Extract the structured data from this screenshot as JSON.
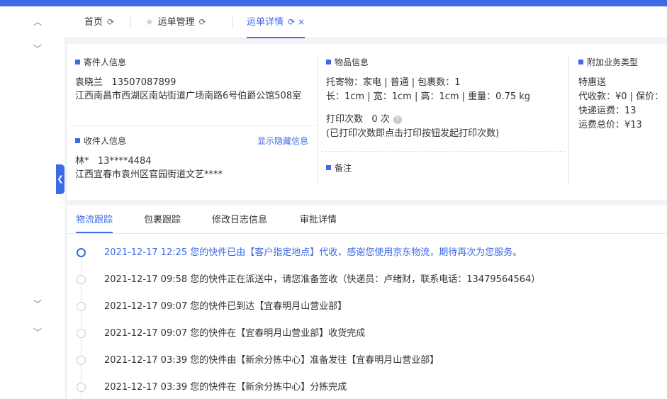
{
  "colors": {
    "accent": "#3d6be6",
    "background": "#f2f3f5"
  },
  "sidebar": {
    "icons": [
      "chevron-up-icon",
      "chevron-down-icon",
      "chevron-down-icon",
      "chevron-down-icon"
    ]
  },
  "tabs": {
    "home": "首页",
    "waybill_mgmt": "运单管理",
    "waybill_detail": "运单详情",
    "refresh_glyph": "⟳",
    "close_glyph": "×",
    "star_glyph": "★"
  },
  "sender": {
    "title": "寄件人信息",
    "name": "袁晓兰",
    "phone": "13507087899",
    "address": "江西南昌市西湖区南站街道广场南路6号伯爵公馆508室"
  },
  "receiver": {
    "title": "收件人信息",
    "show_hidden": "显示隐藏信息",
    "name": "林*",
    "phone": "13****4484",
    "address": "江西宜春市袁州区官园街道文艺****"
  },
  "goods": {
    "title": "物品信息",
    "line1": "托寄物：家电 | 普通 | 包裹数：1",
    "line2": "长：1cm | 宽：1cm | 高：1cm | 重量：0.75 kg",
    "print_label": "打印次数",
    "print_value": "0 次",
    "print_note": "(已打印次数即点击打印按钮发起打印次数)",
    "help_glyph": "?"
  },
  "remark": {
    "title": "备注"
  },
  "extra": {
    "title": "附加业务类型",
    "service": "特惠送",
    "cod": "代收款：¥0 | 保价：",
    "express_fee": "快递运费：13",
    "total_fee": "运费总价：¥13"
  },
  "logistics": {
    "tabs": [
      "物流跟踪",
      "包裹跟踪",
      "修改日志信息",
      "审批详情"
    ],
    "events": [
      "2021-12-17 12:25 您的快件已由【客户指定地点】代收，感谢您使用京东物流，期待再次为您服务。",
      "2021-12-17 09:58 您的快件正在派送中，请您准备签收（快递员：卢绪财，联系电话：13479564564）",
      "2021-12-17 09:07 您的快件已到达【宜春明月山营业部】",
      "2021-12-17 09:07 您的快件在【宜春明月山营业部】收货完成",
      "2021-12-17 03:39 您的快件由【新余分拣中心】准备发往【宜春明月山营业部】",
      "2021-12-17 03:39 您的快件在【新余分拣中心】分拣完成"
    ]
  }
}
